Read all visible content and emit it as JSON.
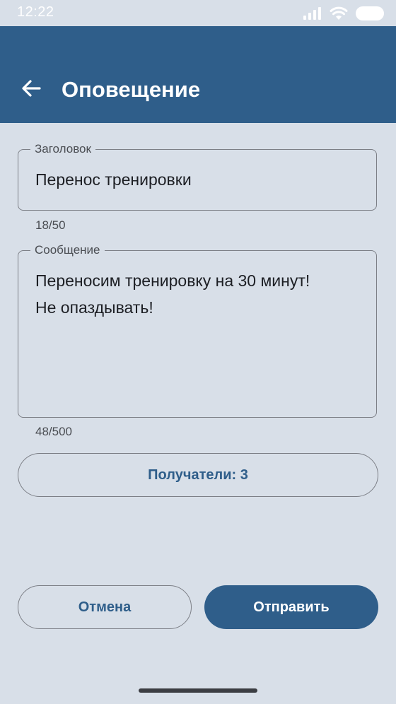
{
  "status_bar": {
    "time": "12:22",
    "icons": [
      "signal-icon",
      "wifi-icon",
      "battery-icon"
    ]
  },
  "app_bar": {
    "title": "Оповещение",
    "back_icon": "arrow-back-icon"
  },
  "form": {
    "title_field": {
      "label": "Заголовок",
      "value": "Перенос тренировки",
      "counter": "18/50"
    },
    "message_field": {
      "label": "Сообщение",
      "value": "Переносим тренировку на 30 минут!\nНе опаздывать!",
      "counter": "48/500"
    },
    "recipients_button": "Получатели: 3"
  },
  "actions": {
    "cancel_label": "Отмена",
    "send_label": "Отправить"
  },
  "colors": {
    "primary": "#2f5e8a",
    "background": "#d8dfe8",
    "outline": "#7c7f86"
  }
}
